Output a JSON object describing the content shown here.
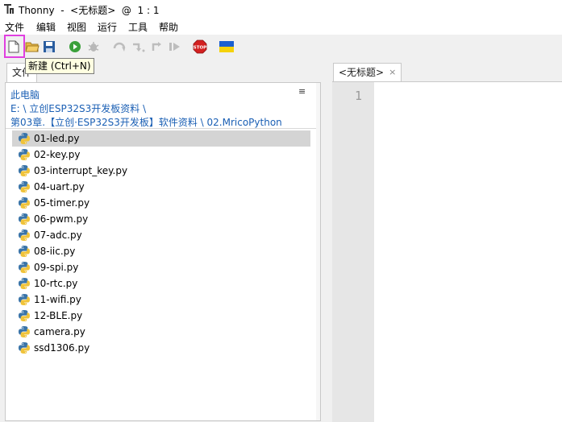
{
  "window": {
    "title": "Thonny  -  <无标题>  @  1 : 1"
  },
  "menu": [
    "文件",
    "编辑",
    "视图",
    "运行",
    "工具",
    "帮助"
  ],
  "toolbar": {
    "tooltip": "新建 (Ctrl+N)",
    "stop_label": "STOP",
    "colors": {
      "run": "#3aa03a",
      "stop": "#d32020",
      "ukraine_blue": "#1a5fd0",
      "ukraine_yellow": "#f5d20a",
      "highlight": "#e040e0"
    }
  },
  "files": {
    "tab_label": "文件",
    "menu_glyph": "≡",
    "path": [
      "此电脑",
      "E: \\ 立创ESP32S3开发板资料 \\",
      "第03章.【立创·ESP32S3开发板】软件资料 \\ 02.MricoPython"
    ],
    "items": [
      "01-led.py",
      "02-key.py",
      "03-interrupt_key.py",
      "04-uart.py",
      "05-timer.py",
      "06-pwm.py",
      "07-adc.py",
      "08-iic.py",
      "09-spi.py",
      "10-rtc.py",
      "11-wifi.py",
      "12-BLE.py",
      "camera.py",
      "ssd1306.py"
    ],
    "selected_index": 0
  },
  "editor": {
    "tab_label": "<无标题>",
    "tab_close": "×",
    "line_numbers": [
      "1"
    ]
  }
}
